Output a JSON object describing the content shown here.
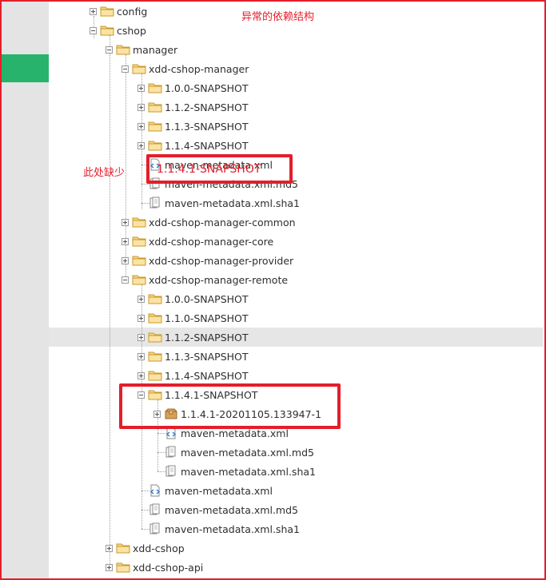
{
  "colors": {
    "annotation": "#e41e2b",
    "left_panel": "#e4e4e4",
    "left_accent": "#27b36b",
    "row_highlight": "#e6e6e6"
  },
  "annotations": {
    "title": "异常的依赖结构",
    "missing_here": "此处缺少",
    "missing_version": "1.1.4.1-SNAPSHOT"
  },
  "tree": {
    "config": "config",
    "cshop": "cshop",
    "manager": "manager",
    "xdd_cshop_manager": {
      "label": "xdd-cshop-manager",
      "versions": [
        "1.0.0-SNAPSHOT",
        "1.1.2-SNAPSHOT",
        "1.1.3-SNAPSHOT",
        "1.1.4-SNAPSHOT"
      ],
      "files": [
        "maven-metadata.xml",
        "maven-metadata.xml.md5",
        "maven-metadata.xml.sha1"
      ]
    },
    "xdd_cshop_manager_common": "xdd-cshop-manager-common",
    "xdd_cshop_manager_core": "xdd-cshop-manager-core",
    "xdd_cshop_manager_provider": "xdd-cshop-manager-provider",
    "xdd_cshop_manager_remote": {
      "label": "xdd-cshop-manager-remote",
      "versions": [
        "1.0.0-SNAPSHOT",
        "1.1.0-SNAPSHOT",
        "1.1.2-SNAPSHOT",
        "1.1.3-SNAPSHOT",
        "1.1.4-SNAPSHOT",
        "1.1.4.1-SNAPSHOT"
      ],
      "snapshot_child": "1.1.4.1-20201105.133947-1",
      "snapshot_files": [
        "maven-metadata.xml",
        "maven-metadata.xml.md5",
        "maven-metadata.xml.sha1"
      ],
      "files": [
        "maven-metadata.xml",
        "maven-metadata.xml.md5",
        "maven-metadata.xml.sha1"
      ]
    },
    "xdd_cshop": "xdd-cshop",
    "xdd_cshop_api": "xdd-cshop-api"
  }
}
